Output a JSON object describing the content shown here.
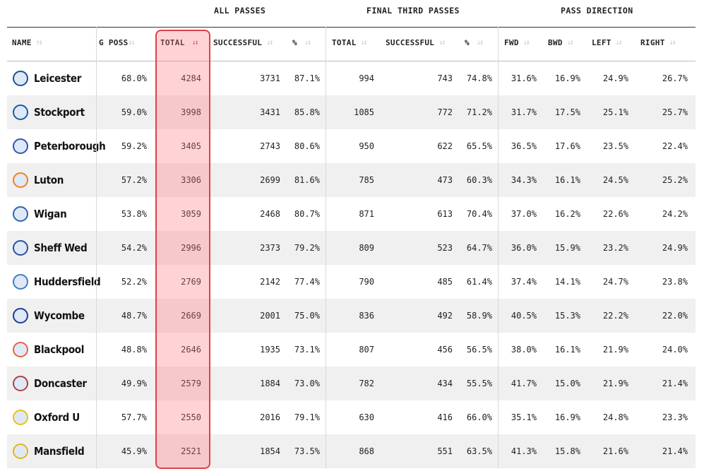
{
  "groups": {
    "all_passes": "ALL PASSES",
    "final_third": "FINAL THIRD PASSES",
    "direction": "PASS DIRECTION"
  },
  "columns": {
    "name": "NAME",
    "poss": "G POSS",
    "total": "TOTAL",
    "successful": "SUCCESSFUL",
    "pct": "%",
    "ft_total": "TOTAL",
    "ft_successful": "SUCCESSFUL",
    "ft_pct": "%",
    "fwd": "FWD",
    "bwd": "BWD",
    "left": "LEFT",
    "right": "RIGHT"
  },
  "sort_icons": {
    "inactive": "↓↕",
    "active": "↓↕",
    "name": "↑↕",
    "active_color": "#e0404a",
    "inactive_color": "#c8c8c8"
  },
  "highlight_color": "#e0404a",
  "rows": [
    {
      "name": "Leicester",
      "poss": "68.0%",
      "total": "4284",
      "successful": "3731",
      "pct": "87.1%",
      "ft_total": "994",
      "ft_successful": "743",
      "ft_pct": "74.8%",
      "fwd": "31.6%",
      "bwd": "16.9%",
      "left": "24.9%",
      "right": "26.7%",
      "crest": "#1d4f9c"
    },
    {
      "name": "Stockport",
      "poss": "59.0%",
      "total": "3998",
      "successful": "3431",
      "pct": "85.8%",
      "ft_total": "1085",
      "ft_successful": "772",
      "ft_pct": "71.2%",
      "fwd": "31.7%",
      "bwd": "17.5%",
      "left": "25.1%",
      "right": "25.7%",
      "crest": "#1e5aa8"
    },
    {
      "name": "Peterborough",
      "poss": "59.2%",
      "total": "3405",
      "successful": "2743",
      "pct": "80.6%",
      "ft_total": "950",
      "ft_successful": "622",
      "ft_pct": "65.5%",
      "fwd": "36.5%",
      "bwd": "17.6%",
      "left": "23.5%",
      "right": "22.4%",
      "crest": "#2b56b5"
    },
    {
      "name": "Luton",
      "poss": "57.2%",
      "total": "3306",
      "successful": "2699",
      "pct": "81.6%",
      "ft_total": "785",
      "ft_successful": "473",
      "ft_pct": "60.3%",
      "fwd": "34.3%",
      "bwd": "16.1%",
      "left": "24.5%",
      "right": "25.2%",
      "crest": "#f0821e"
    },
    {
      "name": "Wigan",
      "poss": "53.8%",
      "total": "3059",
      "successful": "2468",
      "pct": "80.7%",
      "ft_total": "871",
      "ft_successful": "613",
      "ft_pct": "70.4%",
      "fwd": "37.0%",
      "bwd": "16.2%",
      "left": "22.6%",
      "right": "24.2%",
      "crest": "#2d63b0"
    },
    {
      "name": "Sheff Wed",
      "poss": "54.2%",
      "total": "2996",
      "successful": "2373",
      "pct": "79.2%",
      "ft_total": "809",
      "ft_successful": "523",
      "ft_pct": "64.7%",
      "fwd": "36.0%",
      "bwd": "15.9%",
      "left": "23.2%",
      "right": "24.9%",
      "crest": "#2a4fa0"
    },
    {
      "name": "Huddersfield",
      "poss": "52.2%",
      "total": "2769",
      "successful": "2142",
      "pct": "77.4%",
      "ft_total": "790",
      "ft_successful": "485",
      "ft_pct": "61.4%",
      "fwd": "37.4%",
      "bwd": "14.1%",
      "left": "24.7%",
      "right": "23.8%",
      "crest": "#3f7cc6"
    },
    {
      "name": "Wycombe",
      "poss": "48.7%",
      "total": "2669",
      "successful": "2001",
      "pct": "75.0%",
      "ft_total": "836",
      "ft_successful": "492",
      "ft_pct": "58.9%",
      "fwd": "40.5%",
      "bwd": "15.3%",
      "left": "22.2%",
      "right": "22.0%",
      "crest": "#1b3f8f"
    },
    {
      "name": "Blackpool",
      "poss": "48.8%",
      "total": "2646",
      "successful": "1935",
      "pct": "73.1%",
      "ft_total": "807",
      "ft_successful": "456",
      "ft_pct": "56.5%",
      "fwd": "38.0%",
      "bwd": "16.1%",
      "left": "21.9%",
      "right": "24.0%",
      "crest": "#e8643c"
    },
    {
      "name": "Doncaster",
      "poss": "49.9%",
      "total": "2579",
      "successful": "1884",
      "pct": "73.0%",
      "ft_total": "782",
      "ft_successful": "434",
      "ft_pct": "55.5%",
      "fwd": "41.7%",
      "bwd": "15.0%",
      "left": "21.9%",
      "right": "21.4%",
      "crest": "#b0413a"
    },
    {
      "name": "Oxford U",
      "poss": "57.7%",
      "total": "2550",
      "successful": "2016",
      "pct": "79.1%",
      "ft_total": "630",
      "ft_successful": "416",
      "ft_pct": "66.0%",
      "fwd": "35.1%",
      "bwd": "16.9%",
      "left": "24.8%",
      "right": "23.3%",
      "crest": "#e7c020"
    },
    {
      "name": "Mansfield",
      "poss": "45.9%",
      "total": "2521",
      "successful": "1854",
      "pct": "73.5%",
      "ft_total": "868",
      "ft_successful": "551",
      "ft_pct": "63.5%",
      "fwd": "41.3%",
      "bwd": "15.8%",
      "left": "21.6%",
      "right": "21.4%",
      "crest": "#e6b418"
    }
  ]
}
